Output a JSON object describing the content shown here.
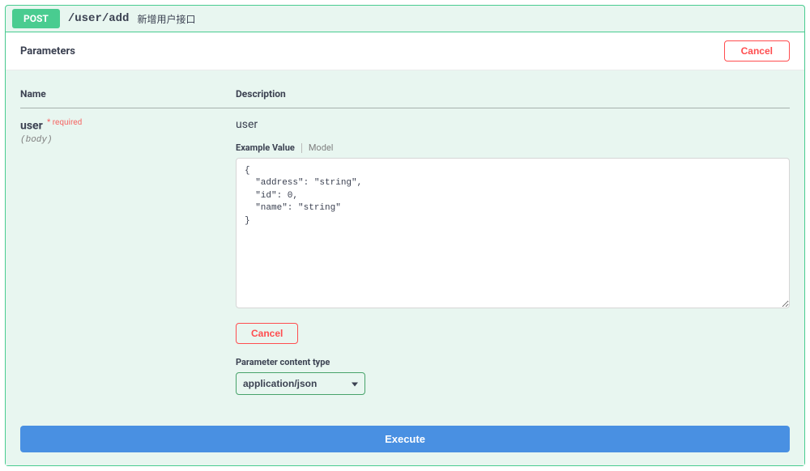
{
  "op": {
    "method": "POST",
    "path": "/user/add",
    "summary": "新增用户接口"
  },
  "section": {
    "parameters_title": "Parameters",
    "cancel_label": "Cancel"
  },
  "columns": {
    "name": "Name",
    "description": "Description"
  },
  "param": {
    "name": "user",
    "required_star": "*",
    "required_text": "required",
    "in": "(body)",
    "description": "user",
    "tabs": {
      "example_value": "Example Value",
      "model": "Model"
    },
    "body_value": "{\n  \"address\": \"string\",\n  \"id\": 0,\n  \"name\": \"string\"\n}",
    "cancel_label": "Cancel",
    "content_type_label": "Parameter content type",
    "content_type_value": "application/json"
  },
  "actions": {
    "execute": "Execute"
  }
}
